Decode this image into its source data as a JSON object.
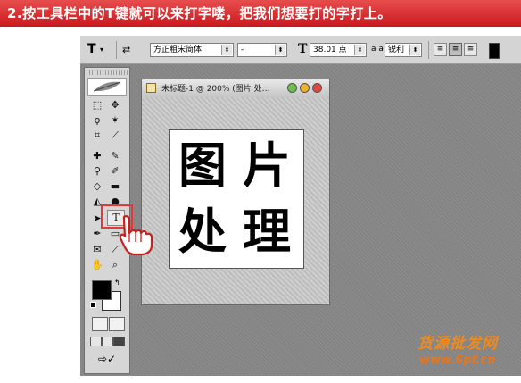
{
  "instruction": "2.按工具栏中的T键就可以来打字喽，把我们想要打的字打上。",
  "options_bar": {
    "tool_icon": "T",
    "font_family": "方正粗宋简体",
    "font_style": "-",
    "font_size": "38.01 点",
    "aa_label": "a a",
    "anti_alias": "锐利"
  },
  "document": {
    "title": "未标题-1 @ 200% (图片 处…",
    "chars": [
      "图",
      "片",
      "处",
      "理"
    ]
  },
  "watermark": {
    "line1": "货源批发网",
    "line2": "www.6pf.cn"
  },
  "colors": {
    "banner": "#d42a2a",
    "highlight": "#e23a3a"
  }
}
